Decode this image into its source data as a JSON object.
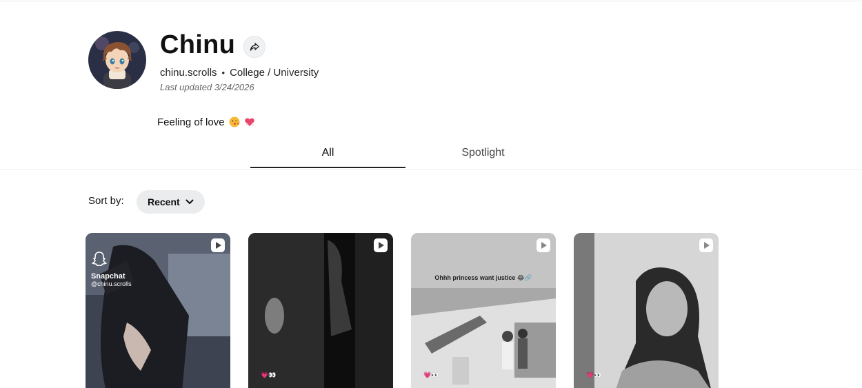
{
  "profile": {
    "name": "Chinu",
    "username": "chinu.scrolls",
    "category": "College / University",
    "last_updated": "Last updated 3/24/2026",
    "bio": "Feeling of love",
    "bio_emojis": [
      "kissing-face-emoji",
      "heart-emoji"
    ]
  },
  "tabs": [
    {
      "label": "All",
      "active": true
    },
    {
      "label": "Spotlight",
      "active": false
    }
  ],
  "sort": {
    "label": "Sort by:",
    "value": "Recent"
  },
  "posts": [
    {
      "watermark_name": "Snapchat",
      "watermark_handle": "@chinu.scrolls",
      "reactions": "",
      "caption": ""
    },
    {
      "watermark_name": "",
      "watermark_handle": "",
      "reactions": "💗👀",
      "caption": ""
    },
    {
      "watermark_name": "",
      "watermark_handle": "",
      "reactions": "💗👀",
      "caption": "Ohhh princess want justice 😂🔗"
    },
    {
      "watermark_name": "",
      "watermark_handle": "",
      "reactions": "💗👀",
      "caption": ""
    }
  ],
  "colors": {
    "tab_underline": "#1f2124",
    "pill_bg": "#ebeced"
  }
}
